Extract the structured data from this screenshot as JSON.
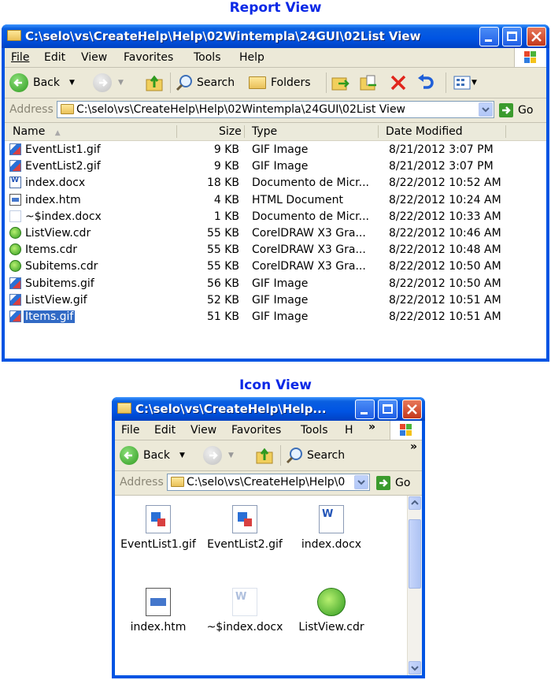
{
  "captions": {
    "report": "Report View",
    "icon": "Icon View"
  },
  "report_window": {
    "title": "C:\\selo\\vs\\CreateHelp\\Help\\02Wintempla\\24GUI\\02List View",
    "menu": [
      "File",
      "Edit",
      "View",
      "Favorites",
      "Tools",
      "Help"
    ],
    "toolbar": {
      "back": "Back",
      "search": "Search",
      "folders": "Folders"
    },
    "address_label": "Address",
    "address_value": "C:\\selo\\vs\\CreateHelp\\Help\\02Wintempla\\24GUI\\02List View",
    "go": "Go",
    "columns": {
      "name": "Name",
      "size": "Size",
      "type": "Type",
      "date": "Date Modified"
    },
    "files": [
      {
        "name": "EventList1.gif",
        "size": "9 KB",
        "type": "GIF Image",
        "date": "8/21/2012 3:07 PM",
        "icon": "gif-file-icon"
      },
      {
        "name": "EventList2.gif",
        "size": "9 KB",
        "type": "GIF Image",
        "date": "8/21/2012 3:07 PM",
        "icon": "gif-file-icon"
      },
      {
        "name": "index.docx",
        "size": "18 KB",
        "type": "Documento de Micr...",
        "date": "8/22/2012 10:52 AM",
        "icon": "word-doc-icon"
      },
      {
        "name": "index.htm",
        "size": "4 KB",
        "type": "HTML Document",
        "date": "8/22/2012 10:24 AM",
        "icon": "html-file-icon"
      },
      {
        "name": "~$index.docx",
        "size": "1 KB",
        "type": "Documento de Micr...",
        "date": "8/22/2012 10:33 AM",
        "icon": "temp-doc-icon"
      },
      {
        "name": "ListView.cdr",
        "size": "55 KB",
        "type": "CorelDRAW X3 Gra...",
        "date": "8/22/2012 10:46 AM",
        "icon": "coreldraw-icon"
      },
      {
        "name": "Items.cdr",
        "size": "55 KB",
        "type": "CorelDRAW X3 Gra...",
        "date": "8/22/2012 10:48 AM",
        "icon": "coreldraw-icon"
      },
      {
        "name": "Subitems.cdr",
        "size": "55 KB",
        "type": "CorelDRAW X3 Gra...",
        "date": "8/22/2012 10:50 AM",
        "icon": "coreldraw-icon"
      },
      {
        "name": "Subitems.gif",
        "size": "56 KB",
        "type": "GIF Image",
        "date": "8/22/2012 10:50 AM",
        "icon": "gif-file-icon"
      },
      {
        "name": "ListView.gif",
        "size": "52 KB",
        "type": "GIF Image",
        "date": "8/22/2012 10:51 AM",
        "icon": "gif-file-icon"
      },
      {
        "name": "Items.gif",
        "size": "51 KB",
        "type": "GIF Image",
        "date": "8/22/2012 10:51 AM",
        "icon": "gif-file-icon",
        "selected": true
      }
    ]
  },
  "icon_window": {
    "title": "C:\\selo\\vs\\CreateHelp\\Help...",
    "menu": [
      "File",
      "Edit",
      "View",
      "Favorites",
      "Tools",
      "H"
    ],
    "chevron": "»",
    "toolbar": {
      "back": "Back",
      "search": "Search",
      "chevron": "»"
    },
    "address_label": "Address",
    "address_value": "C:\\selo\\vs\\CreateHelp\\Help\\0",
    "go": "Go",
    "icons": [
      {
        "name": "EventList1.gif",
        "icon": "gif-file-icon"
      },
      {
        "name": "EventList2.gif",
        "icon": "gif-file-icon"
      },
      {
        "name": "index.docx",
        "icon": "word-doc-icon"
      },
      {
        "name": "index.htm",
        "icon": "html-file-icon"
      },
      {
        "name": "~$index.docx",
        "icon": "temp-doc-icon"
      },
      {
        "name": "ListView.cdr",
        "icon": "coreldraw-icon"
      }
    ]
  },
  "colors": {
    "caption": "#0a28e6",
    "titlebar": "#0054e3",
    "selection": "#316ac5",
    "chrome": "#ece9d8"
  }
}
